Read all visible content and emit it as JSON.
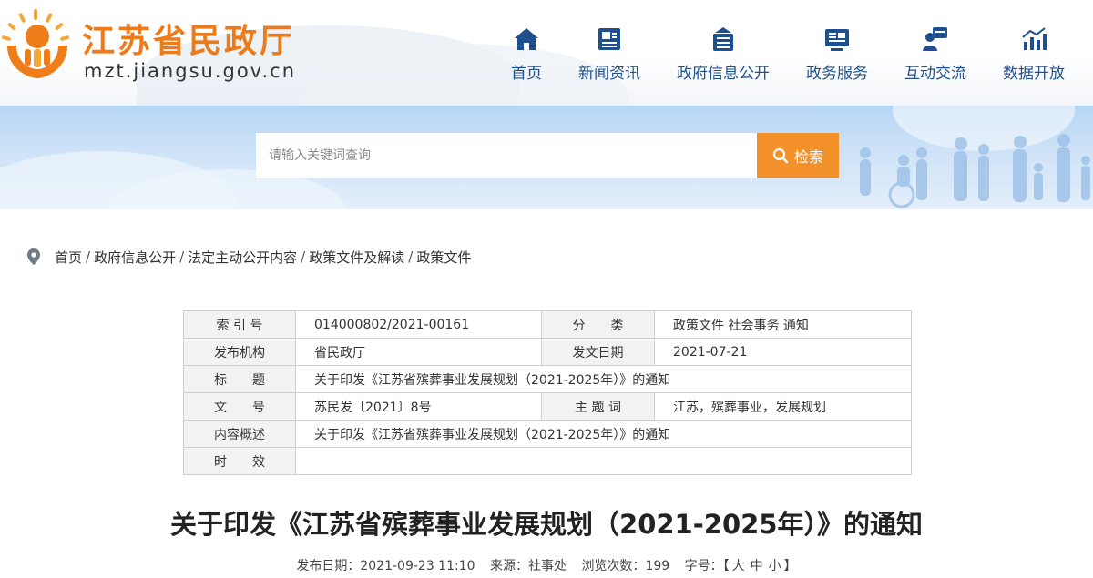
{
  "site": {
    "title": "江苏省民政厅",
    "url": "mzt.jiangsu.gov.cn"
  },
  "nav": [
    {
      "label": "首页",
      "icon": "home-icon"
    },
    {
      "label": "新闻资讯",
      "icon": "news-icon"
    },
    {
      "label": "政府信息公开",
      "icon": "disclosure-icon"
    },
    {
      "label": "政务服务",
      "icon": "service-icon"
    },
    {
      "label": "互动交流",
      "icon": "interaction-icon"
    },
    {
      "label": "数据开放",
      "icon": "data-chart-icon"
    }
  ],
  "search": {
    "placeholder": "请输入关键词查询",
    "button_label": "检索"
  },
  "breadcrumb": [
    "首页",
    "政府信息公开",
    "法定主动公开内容",
    "政策文件及解读",
    "政策文件"
  ],
  "breadcrumb_sep": "/",
  "meta": {
    "rows": [
      {
        "k1": "索 引 号",
        "v1": "014000802/2021-00161",
        "k2": "分　　类",
        "v2": "政策文件 社会事务 通知"
      },
      {
        "k1": "发布机构",
        "v1": "省民政厅",
        "k2": "发文日期",
        "v2": "2021-07-21"
      },
      {
        "k1": "标　　题",
        "v": "关于印发《江苏省殡葬事业发展规划（2021-2025年）》的通知"
      },
      {
        "k1": "文　　号",
        "v1": "苏民发〔2021〕8号",
        "k2": "主 题 词",
        "v2": "江苏，殡葬事业，发展规划"
      },
      {
        "k1": "内容概述",
        "v": "关于印发《江苏省殡葬事业发展规划（2021-2025年）》的通知"
      },
      {
        "k1": "时　　效",
        "v": ""
      }
    ]
  },
  "article": {
    "title": "关于印发《江苏省殡葬事业发展规划（2021-2025年）》的通知",
    "date_label": "发布日期：",
    "date": "2021-09-23 11:10",
    "source_label": "来源：",
    "source": "社事处",
    "views_label": "浏览次数：",
    "views": "199",
    "fontsize_label": "字号：",
    "fs_open": "【",
    "fs_large": "大",
    "fs_medium": "中",
    "fs_small": "小",
    "fs_close": "】"
  },
  "colors": {
    "brand_orange": "#ee7b19",
    "nav_blue": "#1e4f8f",
    "search_button": "#f3922b"
  }
}
